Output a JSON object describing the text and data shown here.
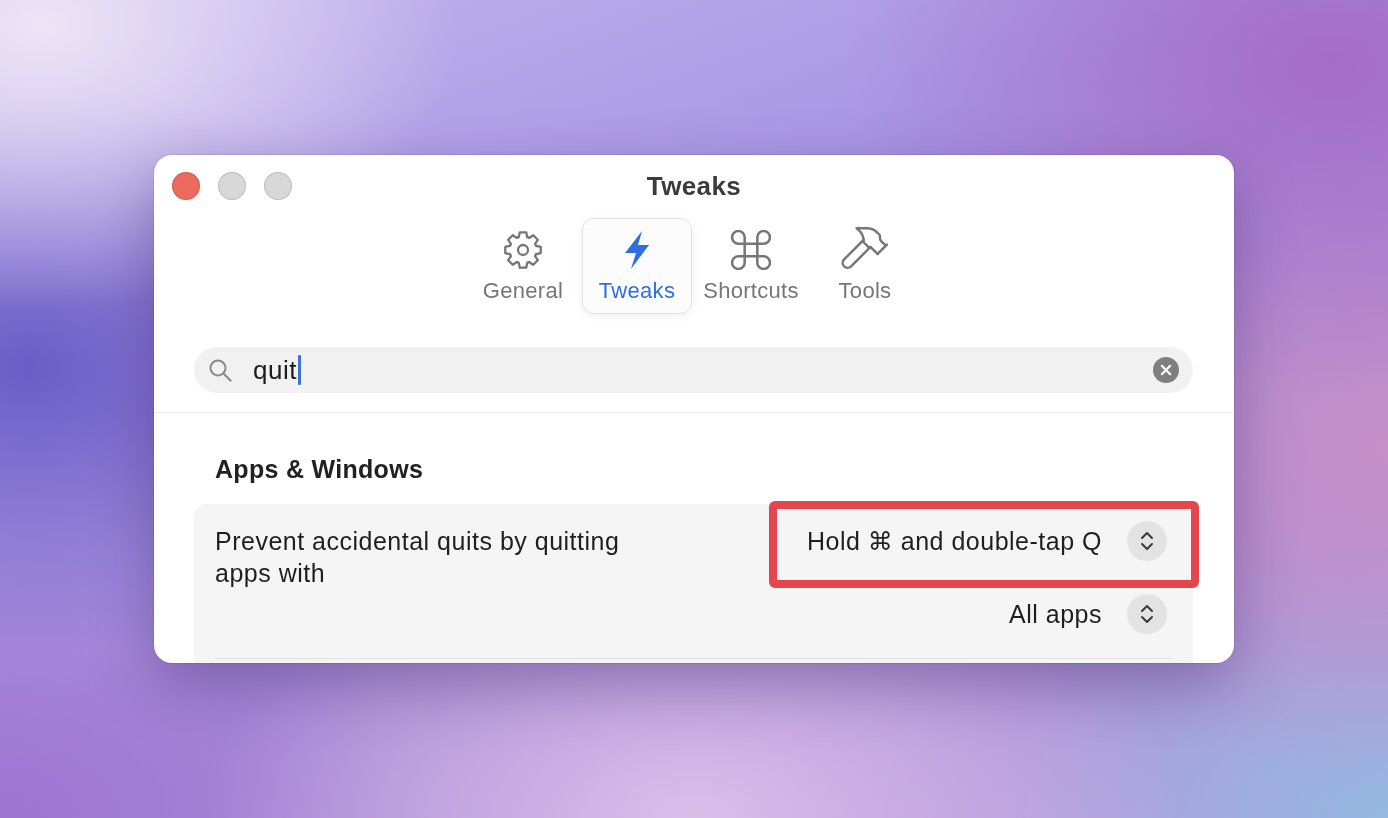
{
  "window": {
    "title": "Tweaks"
  },
  "window_controls": [
    {
      "kind": "close",
      "disabled": false
    },
    {
      "kind": "minimize",
      "disabled": true
    },
    {
      "kind": "zoom",
      "disabled": true
    }
  ],
  "toolbar_tabs": [
    {
      "kind": "general",
      "label": "General",
      "selected": false
    },
    {
      "kind": "tweaks",
      "label": "Tweaks",
      "selected": true
    },
    {
      "kind": "shortcuts",
      "label": "Shortcuts",
      "selected": false
    },
    {
      "kind": "tools",
      "label": "Tools",
      "selected": false
    }
  ],
  "search": {
    "value": "quit",
    "focused": true
  },
  "sections": [
    {
      "heading": "Apps & Windows",
      "settings": [
        {
          "label": "Prevent accidental quits by quitting apps with",
          "popups": [
            {
              "value": "Hold ⌘ and double-tap Q",
              "highlighted": true
            },
            {
              "value": "All apps",
              "highlighted": false
            }
          ]
        }
      ]
    }
  ]
}
